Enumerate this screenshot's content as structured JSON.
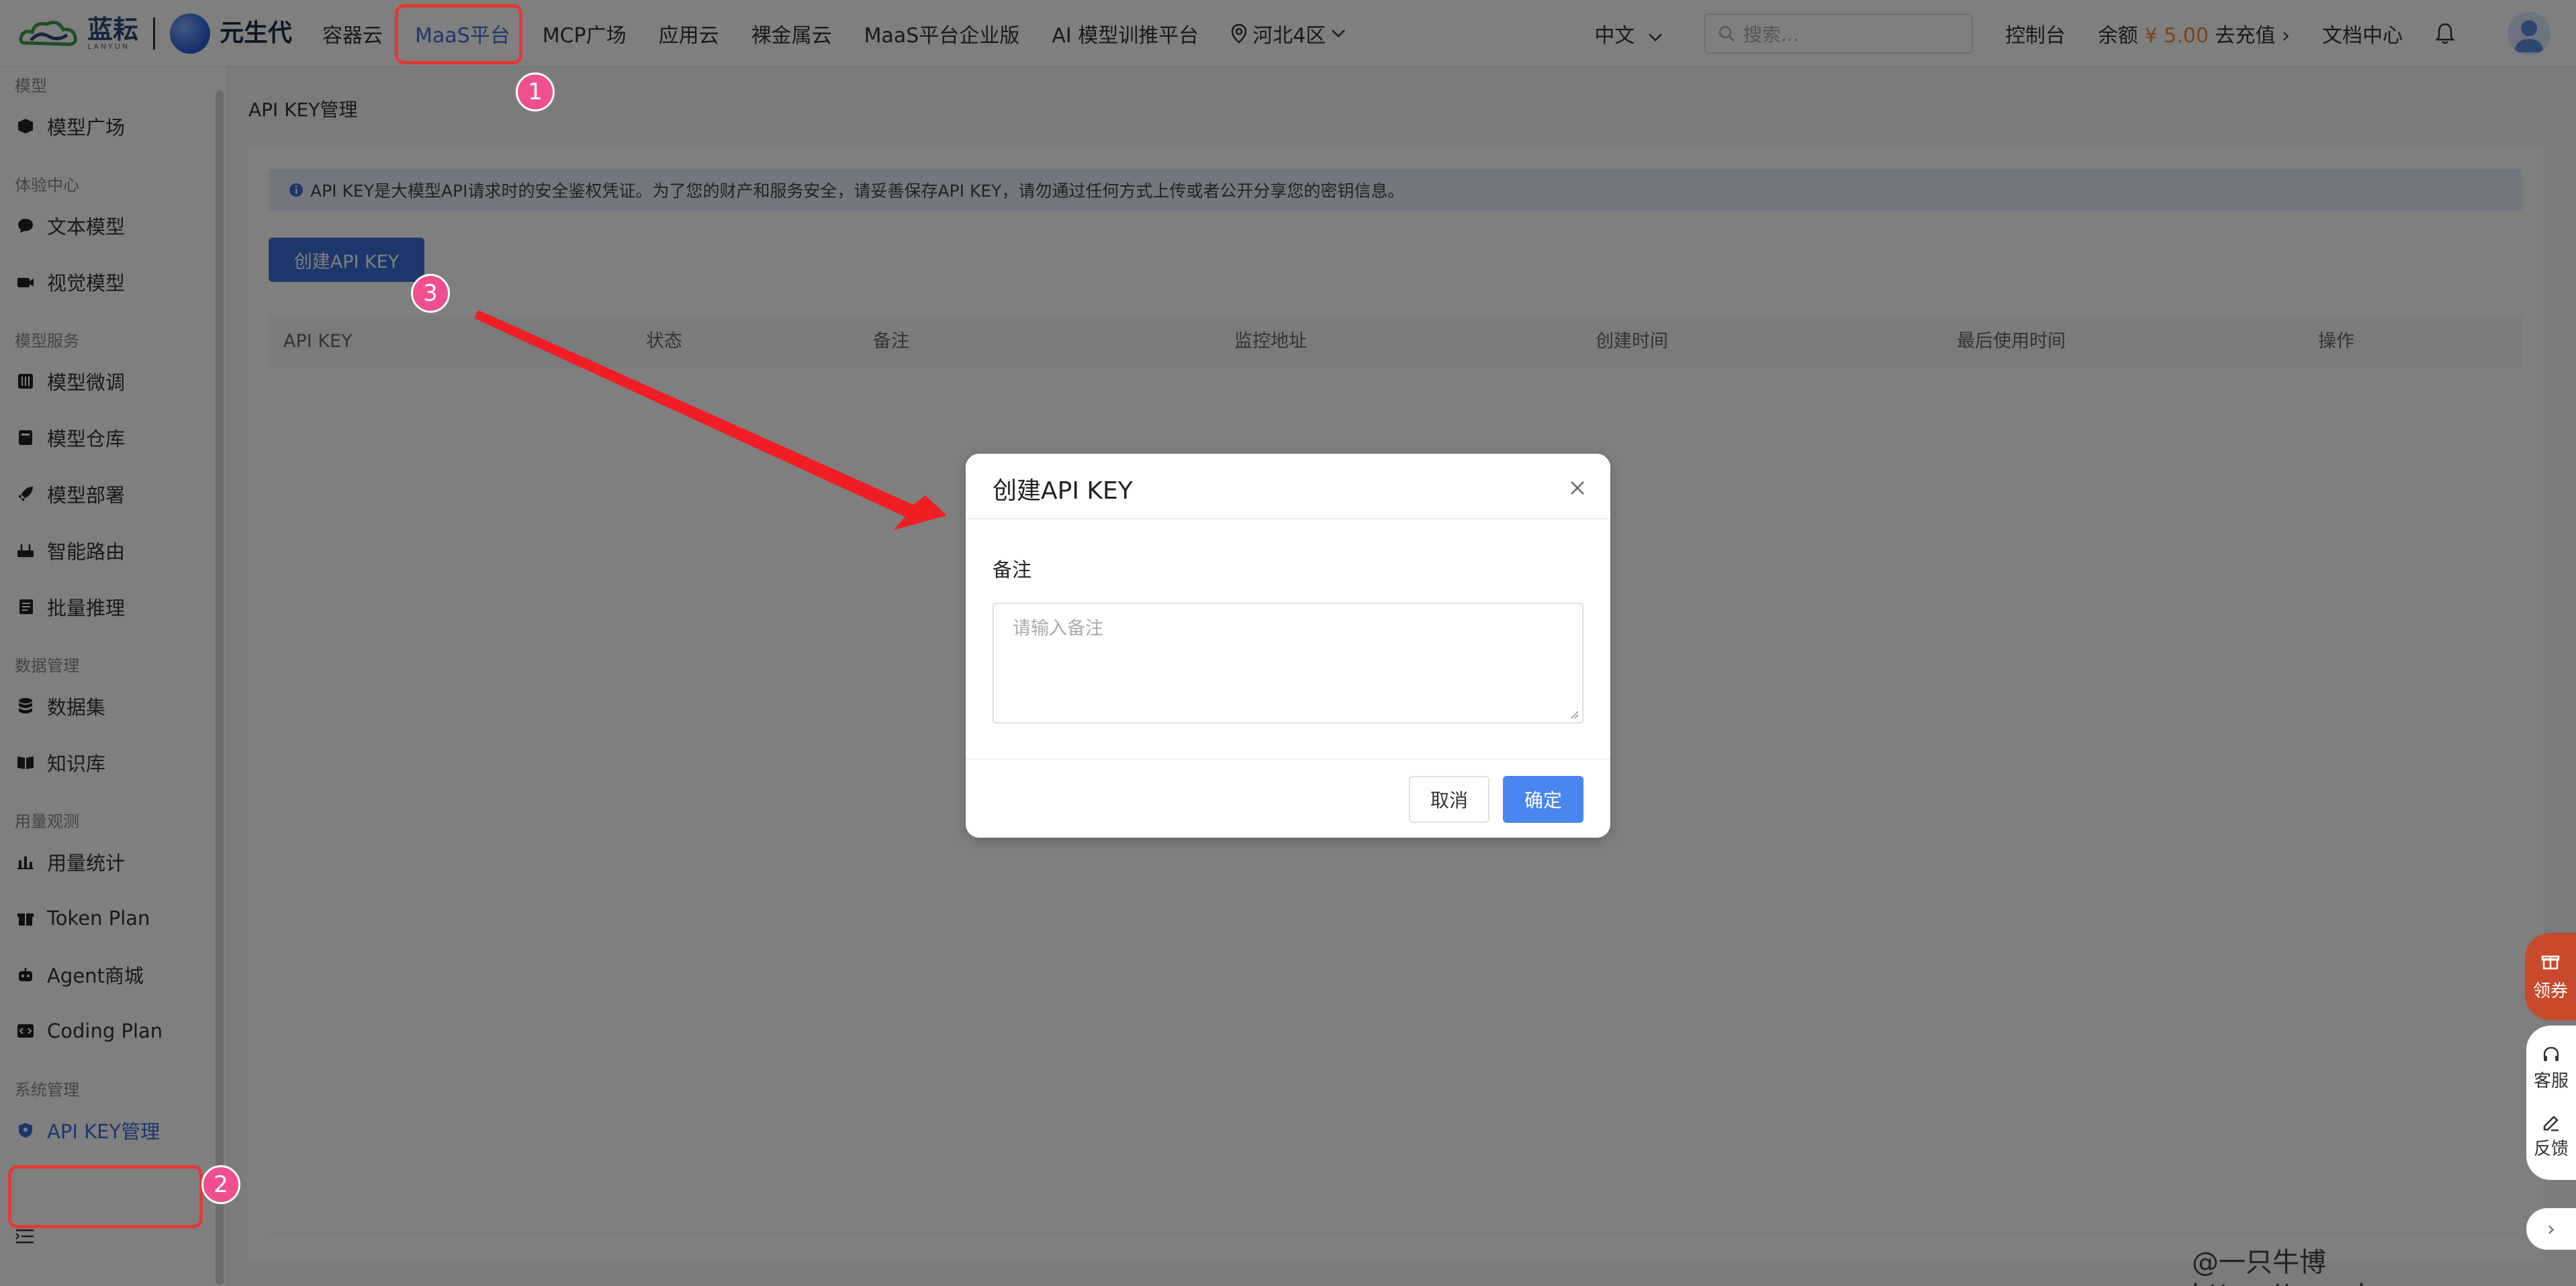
{
  "topbar": {
    "logo_text": "蓝耘",
    "logo_sub": "LANYUN",
    "partner_logo_text": "元生代",
    "nav": [
      "容器云",
      "MaaS平台",
      "MCP广场",
      "应用云",
      "裸金属云",
      "MaaS平台企业版",
      "AI 模型训推平台"
    ],
    "active_nav": "MaaS平台",
    "region": "河北4区",
    "language": "中文",
    "search_placeholder": "搜索...",
    "console": "控制台",
    "balance_label": "余额",
    "balance_amount": "¥ 5.00",
    "recharge": "去充值",
    "docs": "文档中心",
    "bell_icon": "bell-icon",
    "avatar_icon": "user-avatar-icon"
  },
  "sidebar": {
    "groups": [
      {
        "title": "模型",
        "items": [
          {
            "label": "模型广场",
            "icon": "cube-icon"
          }
        ]
      },
      {
        "title": "体验中心",
        "items": [
          {
            "label": "文本模型",
            "icon": "chat-icon"
          },
          {
            "label": "视觉模型",
            "icon": "camera-icon"
          }
        ]
      },
      {
        "title": "模型服务",
        "items": [
          {
            "label": "模型微调",
            "icon": "tune-icon"
          },
          {
            "label": "模型仓库",
            "icon": "archive-icon"
          },
          {
            "label": "模型部署",
            "icon": "rocket-icon"
          },
          {
            "label": "智能路由",
            "icon": "router-icon"
          },
          {
            "label": "批量推理",
            "icon": "batch-icon"
          }
        ]
      },
      {
        "title": "数据管理",
        "items": [
          {
            "label": "数据集",
            "icon": "database-icon"
          },
          {
            "label": "知识库",
            "icon": "book-icon"
          }
        ]
      },
      {
        "title": "用量观测",
        "items": [
          {
            "label": "用量统计",
            "icon": "bar-chart-icon"
          },
          {
            "label": "Token Plan",
            "icon": "gift-icon"
          },
          {
            "label": "Agent商城",
            "icon": "robot-icon"
          },
          {
            "label": "Coding Plan",
            "icon": "code-icon"
          }
        ]
      },
      {
        "title": "系统管理",
        "items": [
          {
            "label": "API KEY管理",
            "icon": "shield-icon",
            "active": true
          }
        ]
      }
    ]
  },
  "main": {
    "breadcrumb": "API KEY管理",
    "notice": "API KEY是大模型API请求时的安全鉴权凭证。为了您的财产和服务安全，请妥善保存API KEY，请勿通过任何方式上传或者公开分享您的密钥信息。",
    "create_button": "创建API KEY",
    "columns": [
      "API KEY",
      "状态",
      "备注",
      "监控地址",
      "创建时间",
      "最后使用时间",
      "操作"
    ]
  },
  "dialog": {
    "title": "创建API KEY",
    "field_label": "备注",
    "placeholder": "请输入备注",
    "cancel": "取消",
    "confirm": "确定"
  },
  "floating": {
    "coupon": "领券",
    "service": "客服",
    "feedback": "反馈"
  },
  "annotations": {
    "step1": "1",
    "step2": "2",
    "step3": "3",
    "arrow_color": "#f01e23",
    "highlight_color": "#e53935"
  },
  "watermark": "@一只牛博 https://acowbo.com"
}
